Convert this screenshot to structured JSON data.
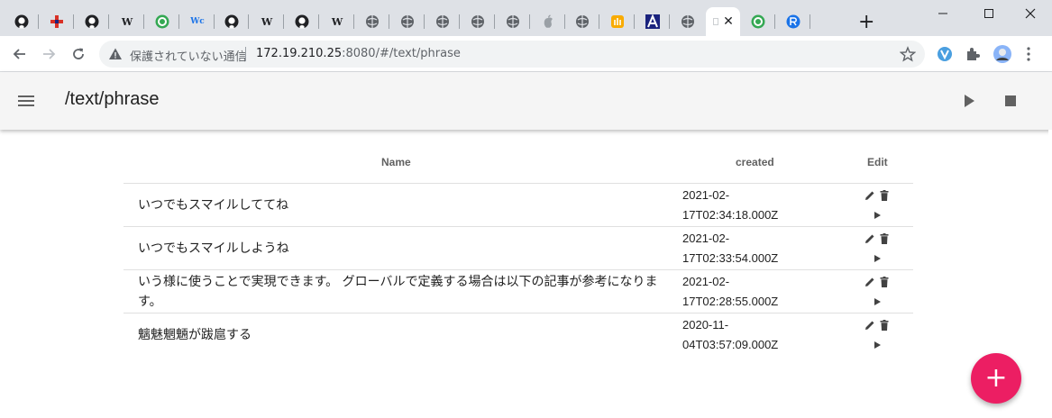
{
  "browser": {
    "tabs": [
      {
        "icon": "github-icon"
      },
      {
        "icon": "red-cross-icon"
      },
      {
        "icon": "github-icon"
      },
      {
        "icon": "wikipedia-icon",
        "glyph": "W"
      },
      {
        "icon": "green-refresh-icon"
      },
      {
        "icon": "wc-icon",
        "glyph": "Wc"
      },
      {
        "icon": "github-icon"
      },
      {
        "icon": "wikipedia-icon",
        "glyph": "W"
      },
      {
        "icon": "github-icon"
      },
      {
        "icon": "wikipedia-icon",
        "glyph": "W"
      },
      {
        "icon": "globe-icon"
      },
      {
        "icon": "globe-icon"
      },
      {
        "icon": "globe-icon"
      },
      {
        "icon": "globe-icon"
      },
      {
        "icon": "globe-icon"
      },
      {
        "icon": "apple-icon"
      },
      {
        "icon": "globe-icon"
      },
      {
        "icon": "hand-icon"
      },
      {
        "icon": "a-logo-icon"
      },
      {
        "icon": "globe-icon"
      },
      {
        "icon": "page-icon",
        "active": true,
        "close": "✕"
      },
      {
        "icon": "green-refresh-icon"
      },
      {
        "icon": "r-logo-icon"
      }
    ],
    "new_tab": "+",
    "security_label": "保護されていない通信",
    "url_host": "172.19.210.25",
    "url_rest": ":8080/#/text/phrase"
  },
  "app": {
    "title": "/text/phrase",
    "columns": {
      "name": "Name",
      "created": "created",
      "edit": "Edit"
    },
    "rows": [
      {
        "name": "いつでもスマイルしててね",
        "created_1": "2021-02-",
        "created_2": "17T02:34:18.000Z"
      },
      {
        "name": "いつでもスマイルしようね",
        "created_1": "2021-02-",
        "created_2": "17T02:33:54.000Z"
      },
      {
        "name": "いう様に使うことで実現できます。 グローバルで定義する場合は以下の記事が参考になります。",
        "created_1": "2021-02-",
        "created_2": "17T02:28:55.000Z"
      },
      {
        "name": "魑魅魍魎が跋扈する",
        "created_1": "2020-11-",
        "created_2": "04T03:57:09.000Z"
      }
    ],
    "fab_label": "+"
  },
  "colors": {
    "fab": "#ec1e63",
    "appbar": "#f5f5f5",
    "tabstrip": "#dee1e6"
  }
}
